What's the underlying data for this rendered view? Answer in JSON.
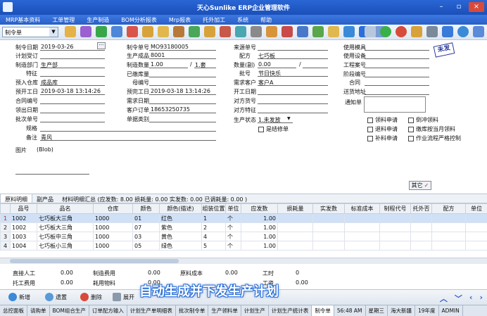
{
  "window": {
    "title": "天心Sunlike ERP企业管理软件"
  },
  "menu": [
    "MRP基本资料",
    "工单管理",
    "生产制造",
    "BOM分析报表",
    "Mrp报表",
    "托外加工",
    "系统",
    "帮助"
  ],
  "toolbar": {
    "doc_type": "制令单"
  },
  "form": {
    "left": [
      {
        "label": "制令日期",
        "value": "2019-03-26"
      },
      {
        "label": "计划受订",
        "value": ""
      },
      {
        "label": "制造部门",
        "value": "生产部"
      },
      {
        "label": "特征",
        "value": ""
      },
      {
        "label": "预入仓库",
        "value": "成品库"
      },
      {
        "label": "预开工日",
        "value": "2019-03-18 13:14:26"
      },
      {
        "label": "合同编号",
        "value": ""
      },
      {
        "label": "领出日期",
        "value": ""
      },
      {
        "label": "批次单号",
        "value": ""
      },
      {
        "label": "规格",
        "value": ""
      },
      {
        "label": "备注",
        "value": "青风"
      },
      {
        "label": "图片",
        "value": "(Blob)"
      }
    ],
    "mid": [
      {
        "label": "制令单号",
        "value": "MO93180005"
      },
      {
        "label": "生产成品",
        "value": "8001"
      },
      {
        "label": "制造数量",
        "value": "1.00"
      },
      {
        "label": "已缴库量",
        "value": ""
      },
      {
        "label": "母编号",
        "value": ""
      },
      {
        "label": "预完工日",
        "value": "2019-03-18 13:14:26"
      },
      {
        "label": "需求日期",
        "value": ""
      },
      {
        "label": "客户订单",
        "value": "18653250735"
      },
      {
        "label": "单据类别",
        "value": ""
      }
    ],
    "unit": {
      "label": "/",
      "value": "1.套"
    },
    "right": [
      {
        "label": "来源单号",
        "value": ""
      },
      {
        "label": "配方",
        "value": "七巧板"
      },
      {
        "label": "数量(副)",
        "value": "0.00"
      },
      {
        "label": "批号",
        "value": "节日快乐"
      },
      {
        "label": "需求客户",
        "value": "客户A"
      },
      {
        "label": "开工日期",
        "value": ""
      },
      {
        "label": "对方货号",
        "value": ""
      },
      {
        "label": "对方特征",
        "value": ""
      },
      {
        "label": "生产状态",
        "value": "1.未发放"
      }
    ],
    "qty_slash": "/",
    "is_repair": "是结修单",
    "far_right": [
      {
        "label": "使用模具",
        "value": ""
      },
      {
        "label": "使用设备",
        "value": ""
      },
      {
        "label": "工程案号",
        "value": ""
      },
      {
        "label": "阶段编号",
        "value": ""
      },
      {
        "label": "合同",
        "value": ""
      },
      {
        "label": "送货地址",
        "value": ""
      }
    ],
    "notice_label": "通知单",
    "stamp": "未发",
    "checks": [
      {
        "label": "领料申请"
      },
      {
        "label": "倒冲领料"
      },
      {
        "label": "退料申请"
      },
      {
        "label": "缴库按当月领料"
      },
      {
        "label": "补料申请"
      },
      {
        "label": "作业流程严格控制"
      }
    ],
    "other_btn": "其它"
  },
  "tabs": [
    {
      "label": "原料明细"
    },
    {
      "label": "副产品"
    },
    {
      "label": "材料明细汇总 (应发数: 8.00 损耗量: 0.00 实发数: 0.00 已调耗量: 0.00 )"
    }
  ],
  "grid": {
    "headers": [
      "",
      "品号",
      "品名",
      "仓库",
      "颜色",
      "颜色(描述)",
      "组装位置",
      "单位",
      "应发数",
      "损耗量",
      "实发数",
      "标准成本",
      "制程代号",
      "托外否",
      "配方",
      "单位"
    ],
    "rows": [
      [
        "1",
        "1002",
        "七巧板大三角",
        "1000",
        "01",
        "红色",
        "1",
        "个",
        "1.00"
      ],
      [
        "2",
        "1002",
        "七巧板大三角",
        "1000",
        "07",
        "紫色",
        "2",
        "个",
        "1.00"
      ],
      [
        "3",
        "1003",
        "七巧板中三角",
        "1000",
        "03",
        "黄色",
        "4",
        "个",
        "1.00"
      ],
      [
        "4",
        "1004",
        "七巧板小三角",
        "1000",
        "05",
        "绿色",
        "5",
        "个",
        "1.00"
      ]
    ]
  },
  "bottom": [
    {
      "label": "直接人工",
      "value": "0.00"
    },
    {
      "label": "制造费用",
      "value": "0.00"
    },
    {
      "label": "原料成本",
      "value": "0.00"
    },
    {
      "label": "工时",
      "value": "0"
    },
    {
      "label": "托工费用",
      "value": "0.00"
    },
    {
      "label": "耗用物料",
      "value": "0.00"
    },
    {
      "label": "工资",
      "value": "0.00"
    }
  ],
  "actions": [
    "新增",
    "遗置",
    "删除",
    "展开"
  ],
  "caption": "自动生成并下发生产计划",
  "taskbar": [
    "总控面板",
    "请购单",
    "BOM组合生产",
    "订单配方输入",
    "计划生产单明细表",
    "批次制令单",
    "生产领料单",
    "计划生产",
    "计划生产统计表",
    "制令单",
    "56:48 AM",
    "星期三",
    "海大新疆",
    "19年度",
    "ADMIN"
  ]
}
